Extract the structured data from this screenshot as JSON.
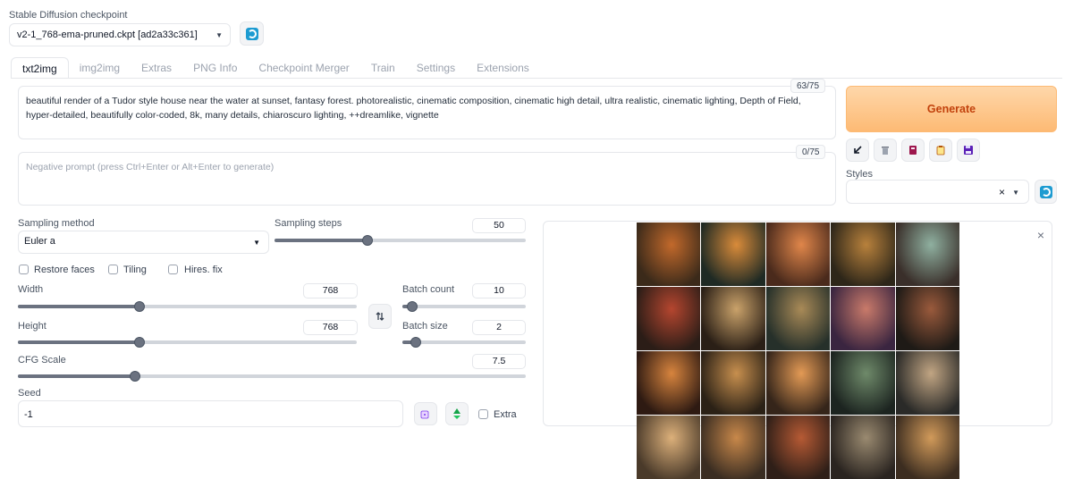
{
  "checkpoint": {
    "label": "Stable Diffusion checkpoint",
    "value": "v2-1_768-ema-pruned.ckpt [ad2a33c361]"
  },
  "tabs": [
    {
      "label": "txt2img",
      "active": true
    },
    {
      "label": "img2img"
    },
    {
      "label": "Extras"
    },
    {
      "label": "PNG Info"
    },
    {
      "label": "Checkpoint Merger"
    },
    {
      "label": "Train"
    },
    {
      "label": "Settings"
    },
    {
      "label": "Extensions"
    }
  ],
  "prompt": {
    "text": "beautiful render of a Tudor style house near the water at sunset, fantasy forest. photorealistic, cinematic composition, cinematic high detail, ultra realistic, cinematic lighting, Depth of Field, hyper-detailed, beautifully color-coded, 8k, many details, chiaroscuro lighting, ++dreamlike, vignette",
    "counter": "63/75"
  },
  "negative_prompt": {
    "placeholder": "Negative prompt (press Ctrl+Enter or Alt+Enter to generate)",
    "counter": "0/75"
  },
  "generate_label": "Generate",
  "styles": {
    "label": "Styles",
    "clear_glyph": "×"
  },
  "sampling": {
    "method_label": "Sampling method",
    "method_value": "Euler a",
    "steps_label": "Sampling steps",
    "steps_value": "50",
    "steps_fraction": 0.37
  },
  "checkboxes": {
    "restore_faces": "Restore faces",
    "tiling": "Tiling",
    "hires_fix": "Hires. fix",
    "extra": "Extra"
  },
  "width": {
    "label": "Width",
    "value": "768",
    "fraction": 0.36
  },
  "height": {
    "label": "Height",
    "value": "768",
    "fraction": 0.36
  },
  "batch_count": {
    "label": "Batch count",
    "value": "10",
    "fraction": 0.08
  },
  "batch_size": {
    "label": "Batch size",
    "value": "2",
    "fraction": 0.11
  },
  "cfg": {
    "label": "CFG Scale",
    "value": "7.5",
    "fraction": 0.23
  },
  "seed": {
    "label": "Seed",
    "value": "-1"
  },
  "gallery": {
    "close_glyph": "×"
  },
  "colors": {
    "accent": "#fdba74",
    "generate_text": "#c2410c",
    "refresh_icon": "#1d9bd1"
  }
}
